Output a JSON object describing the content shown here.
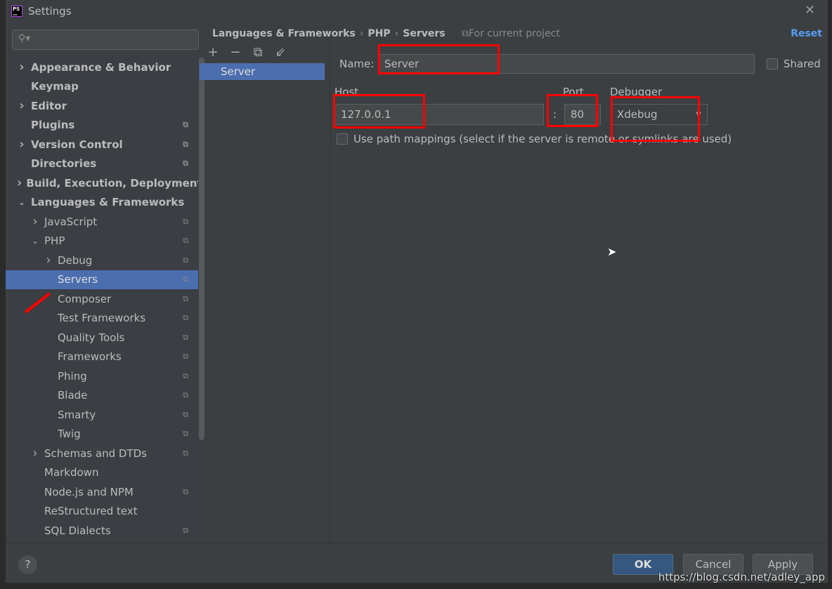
{
  "window": {
    "title": "Settings",
    "logo": "PS"
  },
  "search": {
    "placeholder": ""
  },
  "tree": [
    {
      "label": "Appearance & Behavior",
      "level": 0,
      "arrow": "right",
      "bold": true,
      "copy": false
    },
    {
      "label": "Keymap",
      "level": 0,
      "arrow": "",
      "bold": true,
      "copy": false
    },
    {
      "label": "Editor",
      "level": 0,
      "arrow": "right",
      "bold": true,
      "copy": false
    },
    {
      "label": "Plugins",
      "level": 0,
      "arrow": "",
      "bold": true,
      "copy": true
    },
    {
      "label": "Version Control",
      "level": 0,
      "arrow": "right",
      "bold": true,
      "copy": true
    },
    {
      "label": "Directories",
      "level": 0,
      "arrow": "",
      "bold": true,
      "copy": true
    },
    {
      "label": "Build, Execution, Deployment",
      "level": 0,
      "arrow": "right",
      "bold": true,
      "copy": false
    },
    {
      "label": "Languages & Frameworks",
      "level": 0,
      "arrow": "down",
      "bold": true,
      "copy": false
    },
    {
      "label": "JavaScript",
      "level": 1,
      "arrow": "right",
      "bold": false,
      "copy": true
    },
    {
      "label": "PHP",
      "level": 1,
      "arrow": "down",
      "bold": false,
      "copy": true
    },
    {
      "label": "Debug",
      "level": 2,
      "arrow": "right",
      "bold": false,
      "copy": true
    },
    {
      "label": "Servers",
      "level": 2,
      "arrow": "",
      "bold": false,
      "copy": true,
      "selected": true
    },
    {
      "label": "Composer",
      "level": 2,
      "arrow": "",
      "bold": false,
      "copy": true
    },
    {
      "label": "Test Frameworks",
      "level": 2,
      "arrow": "",
      "bold": false,
      "copy": true
    },
    {
      "label": "Quality Tools",
      "level": 2,
      "arrow": "",
      "bold": false,
      "copy": true
    },
    {
      "label": "Frameworks",
      "level": 2,
      "arrow": "",
      "bold": false,
      "copy": true
    },
    {
      "label": "Phing",
      "level": 2,
      "arrow": "",
      "bold": false,
      "copy": true
    },
    {
      "label": "Blade",
      "level": 2,
      "arrow": "",
      "bold": false,
      "copy": true
    },
    {
      "label": "Smarty",
      "level": 2,
      "arrow": "",
      "bold": false,
      "copy": true
    },
    {
      "label": "Twig",
      "level": 2,
      "arrow": "",
      "bold": false,
      "copy": true
    },
    {
      "label": "Schemas and DTDs",
      "level": 1,
      "arrow": "right",
      "bold": false,
      "copy": true
    },
    {
      "label": "Markdown",
      "level": 1,
      "arrow": "",
      "bold": false,
      "copy": false
    },
    {
      "label": "Node.js and NPM",
      "level": 1,
      "arrow": "",
      "bold": false,
      "copy": true
    },
    {
      "label": "ReStructured text",
      "level": 1,
      "arrow": "",
      "bold": false,
      "copy": false
    },
    {
      "label": "SQL Dialects",
      "level": 1,
      "arrow": "",
      "bold": false,
      "copy": true
    }
  ],
  "breadcrumb": [
    "Languages & Frameworks",
    "PHP",
    "Servers"
  ],
  "scope": "For current project",
  "reset": "Reset",
  "servers": [
    "Server"
  ],
  "form": {
    "name_label": "Name:",
    "name": "Server",
    "shared_label": "Shared",
    "shared": false,
    "host_label": "Host",
    "host": "127.0.0.1",
    "port_label": "Port",
    "port_sep": ":",
    "port": "80",
    "debugger_label": "Debugger",
    "debugger": "Xdebug",
    "path_mappings_label": "Use path mappings (select if the server is remote or symlinks are used)",
    "path_mappings": false
  },
  "footer": {
    "help": "?",
    "ok": "OK",
    "cancel": "Cancel",
    "apply": "Apply"
  },
  "watermark": "https://blog.csdn.net/adley_app",
  "colors": {
    "accent": "#4b6eaf",
    "link": "#589df6",
    "annotation": "#ff0000"
  }
}
